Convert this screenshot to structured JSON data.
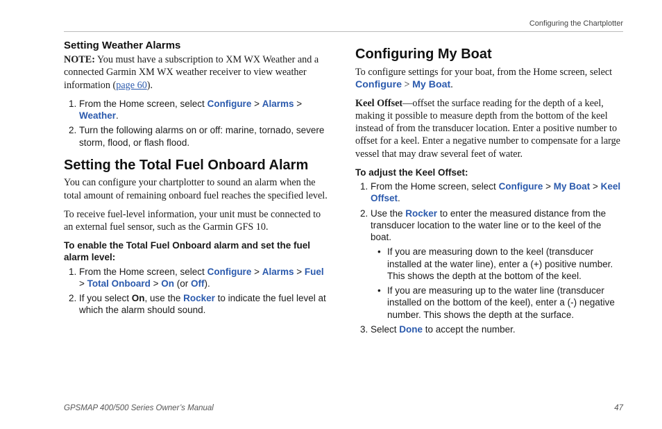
{
  "running_head": "Configuring the Chartplotter",
  "left": {
    "h_weather": "Setting Weather Alarms",
    "note_label": "NOTE:",
    "note_body_a": " You must have a subscription to XM WX Weather and a connected Garmin XM WX weather receiver to view weather information (",
    "page_link": "page 60",
    "note_body_b": ").",
    "step1_a": "From the Home screen, select ",
    "nav_configure": "Configure",
    "sep": " > ",
    "nav_alarms": "Alarms",
    "nav_weather": "Weather",
    "step1_end": ".",
    "step2": "Turn the following alarms on or off: marine, tornado, severe storm, flood, or flash flood.",
    "h_fuel": "Setting the Total Fuel Onboard Alarm",
    "fuel_p1": "You can configure your chartplotter to sound an alarm when the total amount of remaining onboard fuel reaches the specified level.",
    "fuel_p2": "To receive fuel-level information, your unit must be connected to an external fuel sensor, such as the Garmin GFS 10.",
    "fuel_steps_title": "To enable the Total Fuel Onboard alarm and set the fuel alarm level:",
    "fstep1_a": "From the Home screen, select ",
    "nav_fuel": "Fuel",
    "nav_total": "Total Onboard",
    "nav_on": "On",
    "or_txt": " (or ",
    "nav_off": "Off",
    "fstep1_end": ").",
    "fstep2_a": "If you select ",
    "on_txt": "On",
    "fstep2_b": ", use the ",
    "rocker": "Rocker",
    "fstep2_c": " to indicate the fuel level at which the alarm should sound."
  },
  "right": {
    "h_myboat": "Configuring My Boat",
    "p_intro_a": "To configure settings for your boat, from the Home screen, select ",
    "nav_configure": "Configure",
    "sep": " > ",
    "nav_myboat": "My Boat",
    "p_intro_end": ".",
    "keel_label": "Keel Offset",
    "keel_body": "—offset the surface reading for the depth of a keel, making it possible to measure depth from the bottom of the keel instead of from the transducer location. Enter a positive number to offset for a keel. Enter a negative number to compensate for a large vessel that may draw several feet of water.",
    "k_steps_title": "To adjust the Keel Offset:",
    "k1_a": "From the Home screen, select ",
    "nav_keel": "Keel Offset",
    "k1_end": ".",
    "k2_a": "Use the ",
    "k2_b": " to enter the measured distance from the transducer location to the water line or to the keel of the boat.",
    "k2_b1": "If you are measuring down to the keel (transducer installed at the water line), enter a (+) positive number. This shows the depth at the bottom of the keel.",
    "k2_b2": "If you are measuring up to the water line (transducer installed on the bottom of the keel), enter a (-) negative number. This shows the depth at the surface.",
    "k3_a": "Select ",
    "done": "Done",
    "k3_b": " to accept the number."
  },
  "footer": {
    "manual": "GPSMAP 400/500 Series Owner’s Manual",
    "page": "47"
  }
}
